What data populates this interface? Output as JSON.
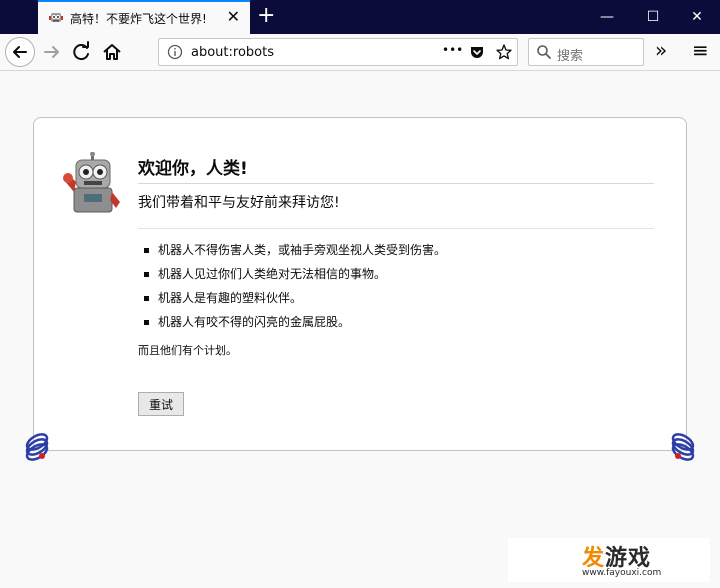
{
  "tab": {
    "title": "高特！不要炸飞这个世界!",
    "close_glyph": "✕",
    "new_tab_glyph": "+"
  },
  "window_controls": {
    "minimize": "—",
    "maximize": "☐",
    "close": "✕"
  },
  "toolbar": {
    "url": "about:robots",
    "page_actions_glyph": "•••",
    "overflow_glyph": "»",
    "menu_glyph": "≡"
  },
  "search": {
    "placeholder": "搜索"
  },
  "page": {
    "heading": "欢迎你，人类!",
    "subheading": "我们带着和平与友好前来拜访您!",
    "laws": [
      "机器人不得伤害人类，或袖手旁观坐视人类受到伤害。",
      "机器人见过你们人类绝对无法相信的事物。",
      "机器人是有趣的塑料伙伴。",
      "机器人有咬不得的闪亮的金属屁股。"
    ],
    "plan": "而且他们有个计划。",
    "retry_label": "重试"
  },
  "watermark": {
    "logo_orange": "发",
    "logo_dark": "游戏",
    "url": "www.fayouxi.com"
  },
  "colors": {
    "titlebar": "#0c0c3b",
    "accent": "#0a84ff",
    "page_bg": "#f9f9fa"
  }
}
